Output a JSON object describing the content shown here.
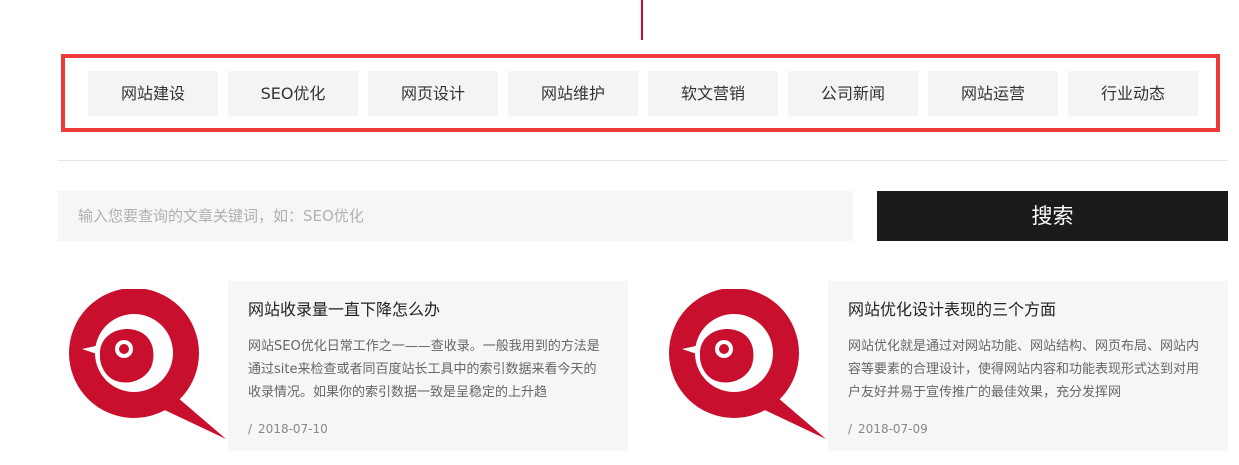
{
  "category_tabs": [
    {
      "label": "网站建设"
    },
    {
      "label": "SEO优化"
    },
    {
      "label": "网页设计"
    },
    {
      "label": "网站维护"
    },
    {
      "label": "软文营销"
    },
    {
      "label": "公司新闻"
    },
    {
      "label": "网站运营"
    },
    {
      "label": "行业动态"
    }
  ],
  "search": {
    "placeholder": "输入您要查询的文章关键词，如：SEO优化",
    "value": "",
    "button_label": "搜索"
  },
  "articles": [
    {
      "title": "网站收录量一直下降怎么办",
      "excerpt": "网站SEO优化日常工作之一——查收录。一般我用到的方法是通过site来检查或者同百度站长工具中的索引数据来看今天的收录情况。如果你的索引数据一致是呈稳定的上升趋",
      "date_separator": "/",
      "date": "2018-07-10",
      "logo_icon": "bird-logo-icon"
    },
    {
      "title": "网站优化设计表现的三个方面",
      "excerpt": "网站优化就是通过对网站功能、网站结构、网页布局、网站内容等要素的合理设计，使得网站内容和功能表现形式达到对用户友好并易于宣传推广的最佳效果，充分发挥网",
      "date_separator": "/",
      "date": "2018-07-09",
      "logo_icon": "bird-logo-icon"
    }
  ],
  "colors": {
    "brand_red": "#c8102e",
    "highlight_frame": "#ee3a3a",
    "search_button_bg": "#1b1b1b",
    "card_bg": "#f6f6f6"
  }
}
